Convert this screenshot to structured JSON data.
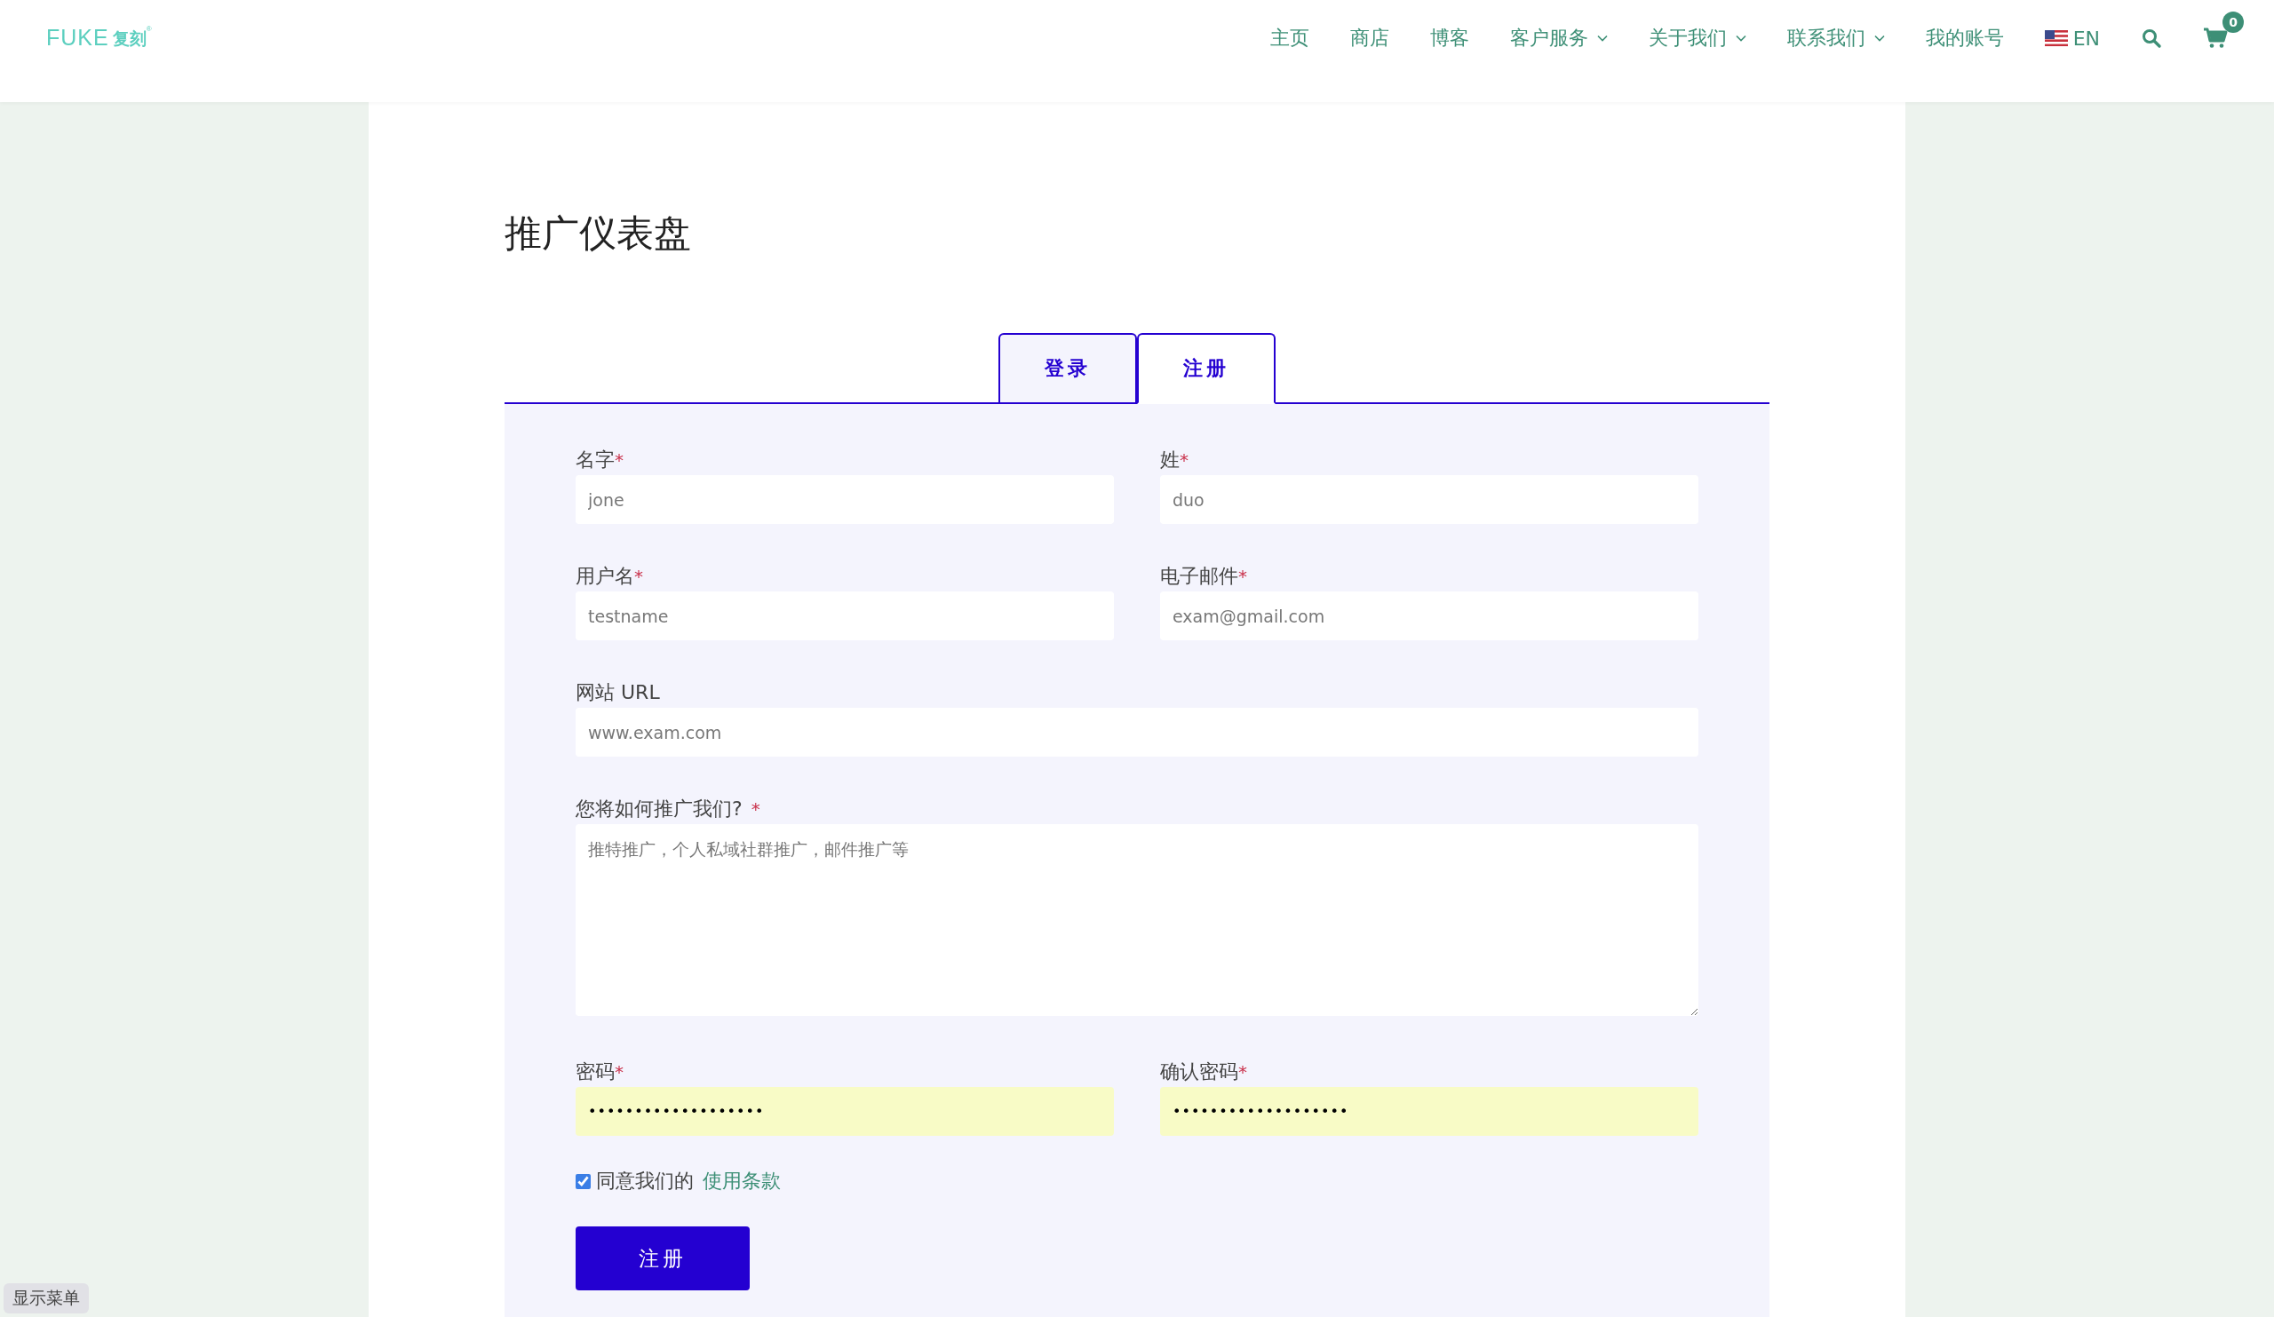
{
  "header": {
    "logo": {
      "latin": "FUKE",
      "chinese": "复刻",
      "mark": "®"
    },
    "nav": [
      {
        "label": "主页",
        "has_dropdown": false
      },
      {
        "label": "商店",
        "has_dropdown": false
      },
      {
        "label": "博客",
        "has_dropdown": false
      },
      {
        "label": "客户服务",
        "has_dropdown": true
      },
      {
        "label": "关于我们",
        "has_dropdown": true
      },
      {
        "label": "联系我们",
        "has_dropdown": true
      },
      {
        "label": "我的账号",
        "has_dropdown": false
      }
    ],
    "language": "EN",
    "cart_count": "0"
  },
  "page_title": "推广仪表盘",
  "tabs": [
    {
      "label": "登录",
      "selected": false
    },
    {
      "label": "注册",
      "selected": true
    }
  ],
  "fields": [
    {
      "kind": "text",
      "label": "名字",
      "required": true,
      "full": false,
      "placeholder": "jone"
    },
    {
      "kind": "text",
      "label": "姓",
      "required": true,
      "full": false,
      "placeholder": "duo"
    },
    {
      "kind": "text",
      "label": "用户名",
      "required": true,
      "full": false,
      "placeholder": "testname"
    },
    {
      "kind": "text",
      "label": "电子邮件",
      "required": true,
      "full": false,
      "placeholder": "exam@gmail.com"
    },
    {
      "kind": "text",
      "label": "网站 URL",
      "required": false,
      "full": true,
      "placeholder": "www.exam.com"
    },
    {
      "kind": "textarea",
      "label": "您将如何推广我们?",
      "required": true,
      "full": true,
      "placeholder": "推特推广，个人私域社群推广，邮件推广等"
    },
    {
      "kind": "password",
      "label": "密码",
      "required": true,
      "full": false,
      "value": "•••••••••••••••••••"
    },
    {
      "kind": "password",
      "label": "确认密码",
      "required": true,
      "full": false,
      "value": "•••••••••••••••••••"
    }
  ],
  "required_mark": "*",
  "terms": {
    "checked": true,
    "text": "同意我们的",
    "link": "使用条款"
  },
  "submit": "注册",
  "show_menu": "显示菜单"
}
